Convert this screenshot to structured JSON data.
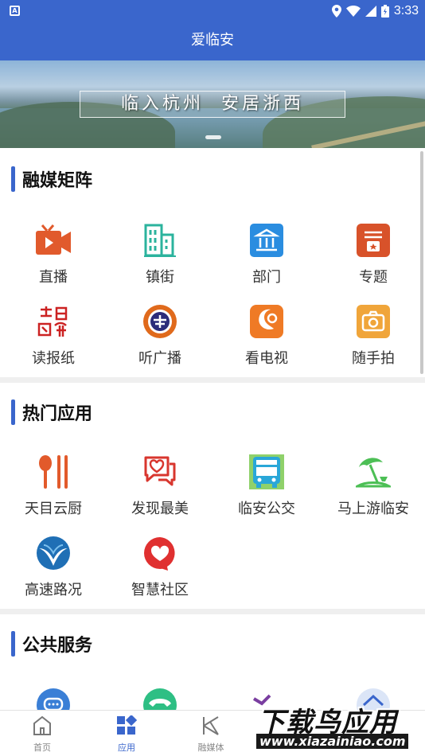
{
  "status_bar": {
    "time": "3:33",
    "notification_glyph": "A"
  },
  "header": {
    "title": "爱临安"
  },
  "banner": {
    "slogan": "临入杭州  安居浙西"
  },
  "sections": [
    {
      "title": "融媒矩阵",
      "items": [
        {
          "label": "直播",
          "icon": "live-camera-icon",
          "color": "#e15a2c"
        },
        {
          "label": "镇街",
          "icon": "buildings-icon",
          "color": "#2bb39d"
        },
        {
          "label": "部门",
          "icon": "government-building-icon",
          "color": "#2a8de0"
        },
        {
          "label": "专题",
          "icon": "topic-icon",
          "color": "#d8522a"
        },
        {
          "label": "读报纸",
          "icon": "newspaper-logo-icon",
          "color": "#cc2222"
        },
        {
          "label": "听广播",
          "icon": "radio-logo-icon",
          "color": "#e06a1c"
        },
        {
          "label": "看电视",
          "icon": "tv-logo-icon",
          "color": "#ef7a25"
        },
        {
          "label": "随手拍",
          "icon": "camera-icon",
          "color": "#f0a53a"
        }
      ]
    },
    {
      "title": "热门应用",
      "items": [
        {
          "label": "天目云厨",
          "icon": "spoon-chopsticks-icon",
          "color": "#e25a2b"
        },
        {
          "label": "发现最美",
          "icon": "heart-chat-icon",
          "color": "#d8362e"
        },
        {
          "label": "临安公交",
          "icon": "bus-icon",
          "color": "#29a7d8"
        },
        {
          "label": "马上游临安",
          "icon": "beach-umbrella-icon",
          "color": "#4cbf55"
        },
        {
          "label": "高速路况",
          "icon": "highway-icon",
          "color": "#1f6fb5"
        },
        {
          "label": "智慧社区",
          "icon": "heart-bubble-icon",
          "color": "#e03030"
        }
      ]
    },
    {
      "title": "公共服务",
      "items": [
        {
          "label": "",
          "icon": "chat-bubble-icon",
          "color": "#3a7fd6"
        },
        {
          "label": "",
          "icon": "phone-icon",
          "color": "#2ebf84"
        },
        {
          "label": "",
          "icon": "service-icon",
          "color": "#7a3ea0"
        },
        {
          "label": "",
          "icon": "home-service-icon",
          "color": "#3a66cc"
        }
      ]
    }
  ],
  "bottom_nav": [
    {
      "label": "首页",
      "icon": "home-icon",
      "active": false
    },
    {
      "label": "应用",
      "icon": "apps-grid-icon",
      "active": true
    },
    {
      "label": "融媒体",
      "icon": "media-icon",
      "active": false
    }
  ],
  "watermark": {
    "main": "下载鸟应用",
    "url": "www.xiazainiao.com"
  }
}
